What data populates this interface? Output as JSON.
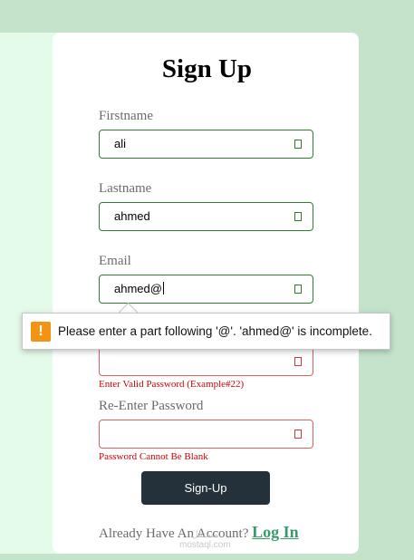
{
  "form": {
    "title": "Sign Up",
    "firstname": {
      "label": "Firstname",
      "value": "ali"
    },
    "lastname": {
      "label": "Lastname",
      "value": "ahmed"
    },
    "email": {
      "label": "Email",
      "value": "ahmed@"
    },
    "password": {
      "value": "",
      "error": "Enter Valid Password (Example#22)"
    },
    "reenter": {
      "label": "Re-Enter Password",
      "value": "",
      "error": "Password Cannot Be Blank"
    },
    "submit_label": "Sign-Up"
  },
  "footer": {
    "text": "Already Have An Account?",
    "login_label": "Log In"
  },
  "watermark": {
    "line1": "مستقل",
    "line2": "mostaql.com"
  },
  "tooltip": {
    "message": "Please enter a part following '@'. 'ahmed@' is incomplete.",
    "icon": "!"
  },
  "colors": {
    "accent": "#3a9a6a",
    "error": "#d00000",
    "button": "#25313a",
    "valid_border": "#2e7d32"
  }
}
